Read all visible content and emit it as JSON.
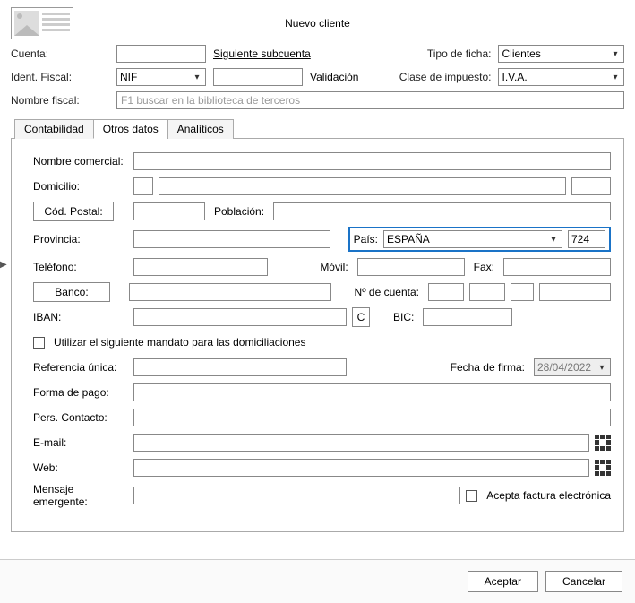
{
  "title": "Nuevo cliente",
  "top": {
    "cuenta_label": "Cuenta:",
    "siguiente_subcuenta": "Siguiente subcuenta",
    "tipo_ficha_label": "Tipo de ficha:",
    "tipo_ficha_value": "Clientes",
    "ident_fiscal_label": "Ident. Fiscal:",
    "ident_fiscal_type": "NIF",
    "validacion": "Validación",
    "clase_impuesto_label": "Clase de impuesto:",
    "clase_impuesto_value": "I.V.A.",
    "nombre_fiscal_label": "Nombre fiscal:",
    "nombre_fiscal_placeholder": "F1 buscar en la biblioteca de terceros"
  },
  "tabs": {
    "contabilidad": "Contabilidad",
    "otros_datos": "Otros datos",
    "analiticos": "Analíticos"
  },
  "otros": {
    "nombre_comercial": "Nombre comercial:",
    "domicilio": "Domicilio:",
    "cod_postal_btn": "Cód. Postal:",
    "poblacion": "Población:",
    "provincia": "Provincia:",
    "pais_label": "País:",
    "pais_value": "ESPAÑA",
    "pais_code": "724",
    "telefono": "Teléfono:",
    "movil": "Móvil:",
    "fax": "Fax:",
    "banco_btn": "Banco:",
    "n_cuenta": "Nº de cuenta:",
    "iban": "IBAN:",
    "c_btn": "C",
    "bic": "BIC:",
    "mandato_check": "Utilizar el siguiente mandato para las domiciliaciones",
    "ref_unica": "Referencia única:",
    "fecha_firma_label": "Fecha de firma:",
    "fecha_firma_value": "28/04/2022",
    "forma_pago": "Forma de pago:",
    "pers_contacto": "Pers. Contacto:",
    "email": "E-mail:",
    "web": "Web:",
    "mensaje": "Mensaje emergente:",
    "acepta_factura": "Acepta factura electrónica"
  },
  "footer": {
    "aceptar": "Aceptar",
    "cancelar": "Cancelar"
  }
}
